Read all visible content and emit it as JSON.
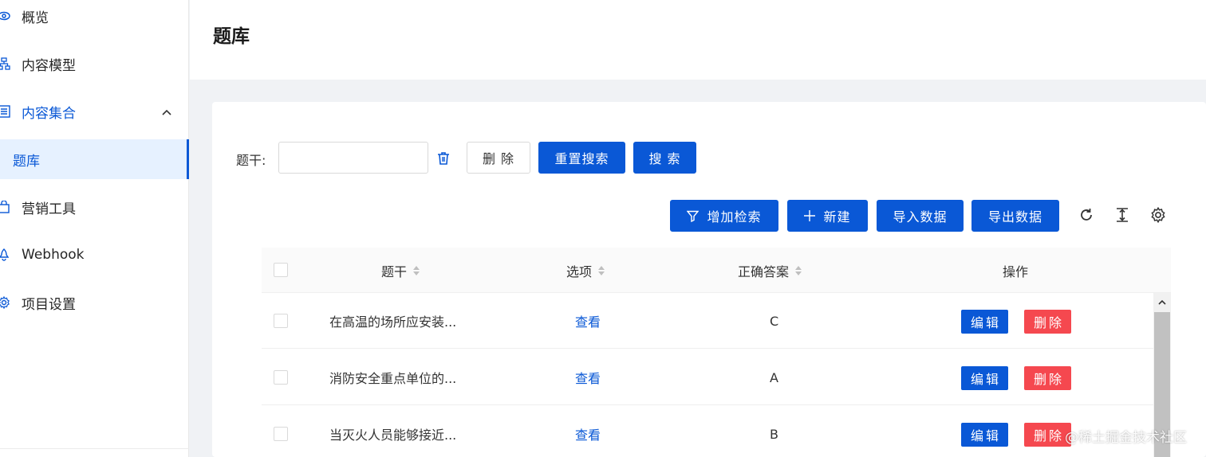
{
  "sidebar": {
    "items": [
      {
        "label": "概览",
        "icon": "eye-icon"
      },
      {
        "label": "内容模型",
        "icon": "sitemap-icon"
      },
      {
        "label": "内容集合",
        "icon": "list-icon"
      },
      {
        "label": "题库",
        "icon": ""
      },
      {
        "label": "营销工具",
        "icon": "shopping-bag-icon"
      },
      {
        "label": "Webhook",
        "icon": "webhook-icon"
      },
      {
        "label": "项目设置",
        "icon": "gear-icon"
      }
    ]
  },
  "header": {
    "title": "题库"
  },
  "search": {
    "label": "题干:",
    "value": "",
    "clear_label": "删 除",
    "reset_label": "重置搜索",
    "search_label": "搜 索"
  },
  "toolbar": {
    "add_filter_label": "增加检索",
    "new_label": "新建",
    "import_label": "导入数据",
    "export_label": "导出数据"
  },
  "table": {
    "columns": [
      "题干",
      "选项",
      "正确答案",
      "操作"
    ],
    "rows": [
      {
        "stem": "在高温的场所应安装...",
        "options": "查看",
        "answer": "C",
        "edit": "编辑",
        "delete": "删除"
      },
      {
        "stem": "消防安全重点单位的...",
        "options": "查看",
        "answer": "A",
        "edit": "编辑",
        "delete": "删除"
      },
      {
        "stem": "当灭火人员能够接近...",
        "options": "查看",
        "answer": "B",
        "edit": "编辑",
        "delete": "删除"
      }
    ]
  },
  "watermark": "@稀土掘金技术社区",
  "colors": {
    "primary": "#0a58d6",
    "danger": "#f5484f",
    "selected_bg": "#e6f1ff"
  }
}
